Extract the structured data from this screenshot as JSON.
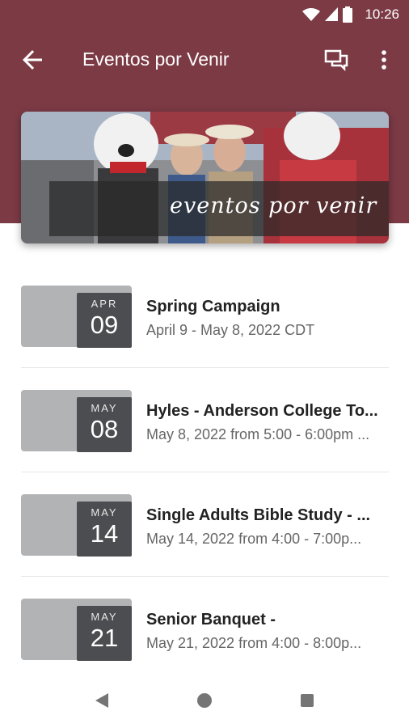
{
  "status_bar": {
    "time": "10:26"
  },
  "app_bar": {
    "title": "Eventos por Venir"
  },
  "banner": {
    "text": "eventos por venir"
  },
  "events": [
    {
      "month": "APR",
      "day": "09",
      "title": "Spring Campaign",
      "subtitle": "April 9 - May 8, 2022 CDT"
    },
    {
      "month": "MAY",
      "day": "08",
      "title": "Hyles - Anderson College To...",
      "subtitle": "May 8, 2022 from 5:00 - 6:00pm ..."
    },
    {
      "month": "MAY",
      "day": "14",
      "title": "Single Adults Bible Study - ...",
      "subtitle": "May 14, 2022 from 4:00 - 7:00p..."
    },
    {
      "month": "MAY",
      "day": "21",
      "title": "Senior Banquet -",
      "subtitle": "May 21, 2022 from 4:00 - 8:00p..."
    }
  ],
  "colors": {
    "header": "#7c3a45",
    "date_box": "#4c4d50",
    "thumb": "#b2b3b5"
  },
  "icons": [
    "wifi-icon",
    "signal-icon",
    "battery-icon",
    "back-arrow-icon",
    "chat-icon",
    "more-vert-icon",
    "nav-back-icon",
    "nav-home-icon",
    "nav-recent-icon"
  ]
}
